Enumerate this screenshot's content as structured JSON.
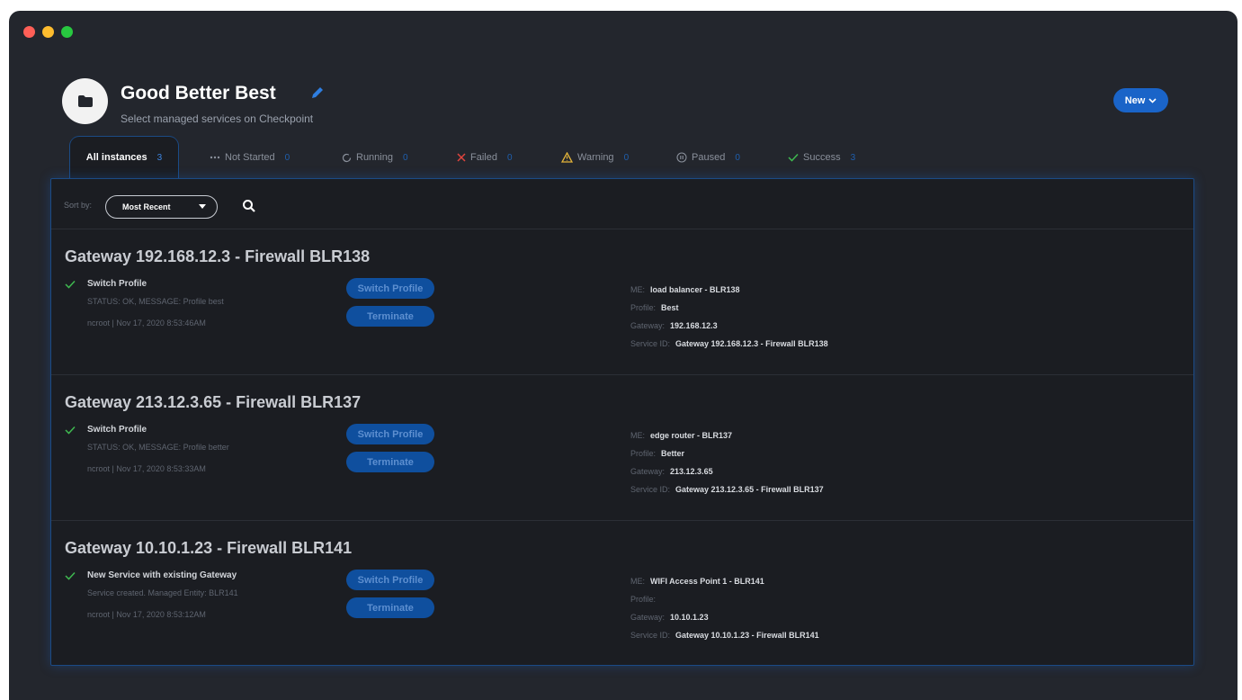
{
  "header": {
    "title": "Good Better Best",
    "subtitle": "Select managed services on Checkpoint",
    "new_label": "New"
  },
  "tabs": [
    {
      "label": "All instances",
      "count": "3",
      "icon": "none"
    },
    {
      "label": "Not Started",
      "count": "0",
      "icon": "dots-icon"
    },
    {
      "label": "Running",
      "count": "0",
      "icon": "refresh-icon"
    },
    {
      "label": "Failed",
      "count": "0",
      "icon": "x-icon"
    },
    {
      "label": "Warning",
      "count": "0",
      "icon": "warning-icon"
    },
    {
      "label": "Paused",
      "count": "0",
      "icon": "pause-icon"
    },
    {
      "label": "Success",
      "count": "3",
      "icon": "check-icon"
    }
  ],
  "sort": {
    "label": "Sort by:",
    "value": "Most Recent"
  },
  "buttons": {
    "switch_profile": "Switch Profile",
    "terminate": "Terminate"
  },
  "detail_labels": {
    "me": "ME:",
    "profile": "Profile:",
    "gateway": "Gateway:",
    "service_id": "Service ID:"
  },
  "instances": [
    {
      "title": "Gateway 192.168.12.3 - Firewall BLR138",
      "activity": "Switch Profile",
      "status": "STATUS: OK, MESSAGE: Profile best",
      "meta": "ncroot | Nov 17, 2020 8:53:46AM",
      "me": "load balancer - BLR138",
      "profile": "Best",
      "gateway": "192.168.12.3",
      "service_id": "Gateway 192.168.12.3 - Firewall BLR138"
    },
    {
      "title": "Gateway 213.12.3.65 - Firewall BLR137",
      "activity": "Switch Profile",
      "status": "STATUS: OK, MESSAGE: Profile better",
      "meta": "ncroot | Nov 17, 2020 8:53:33AM",
      "me": "edge router - BLR137",
      "profile": "Better",
      "gateway": "213.12.3.65",
      "service_id": "Gateway 213.12.3.65 - Firewall BLR137"
    },
    {
      "title": "Gateway 10.10.1.23 - Firewall BLR141",
      "activity": "New Service with existing Gateway",
      "status": "Service created. Managed Entity: BLR141",
      "meta": "ncroot | Nov 17, 2020 8:53:12AM",
      "me": "WIFI Access Point 1 - BLR141",
      "profile": "",
      "gateway": "10.10.1.23",
      "service_id": "Gateway 10.10.1.23 - Firewall BLR141"
    }
  ]
}
